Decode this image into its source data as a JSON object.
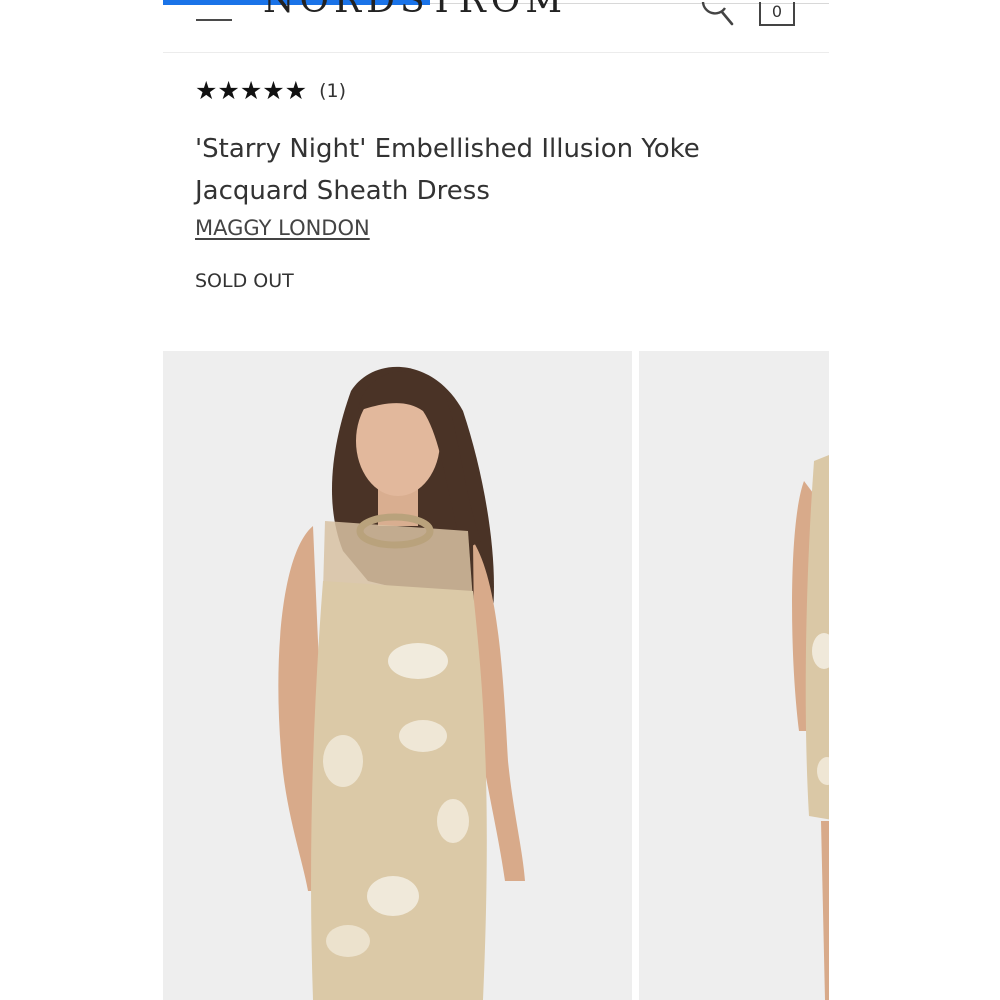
{
  "header": {
    "logo_text": "NORDSTROM",
    "bag_count": "0",
    "menu_icon": "hamburger-menu-icon",
    "search_icon": "search-icon"
  },
  "product": {
    "rating_stars": "★★★★★",
    "rating_value": 5,
    "review_count": "(1)",
    "title": "'Starry Night' Embellished Illusion Yoke Jacquard Sheath Dress",
    "brand": "MAGGY LONDON",
    "status": "SOLD OUT"
  },
  "colors": {
    "accent_progress": "#1a73e8",
    "text": "#333333",
    "photo_bg": "#eeeeee",
    "dress_gold": "#d9c7a3"
  }
}
